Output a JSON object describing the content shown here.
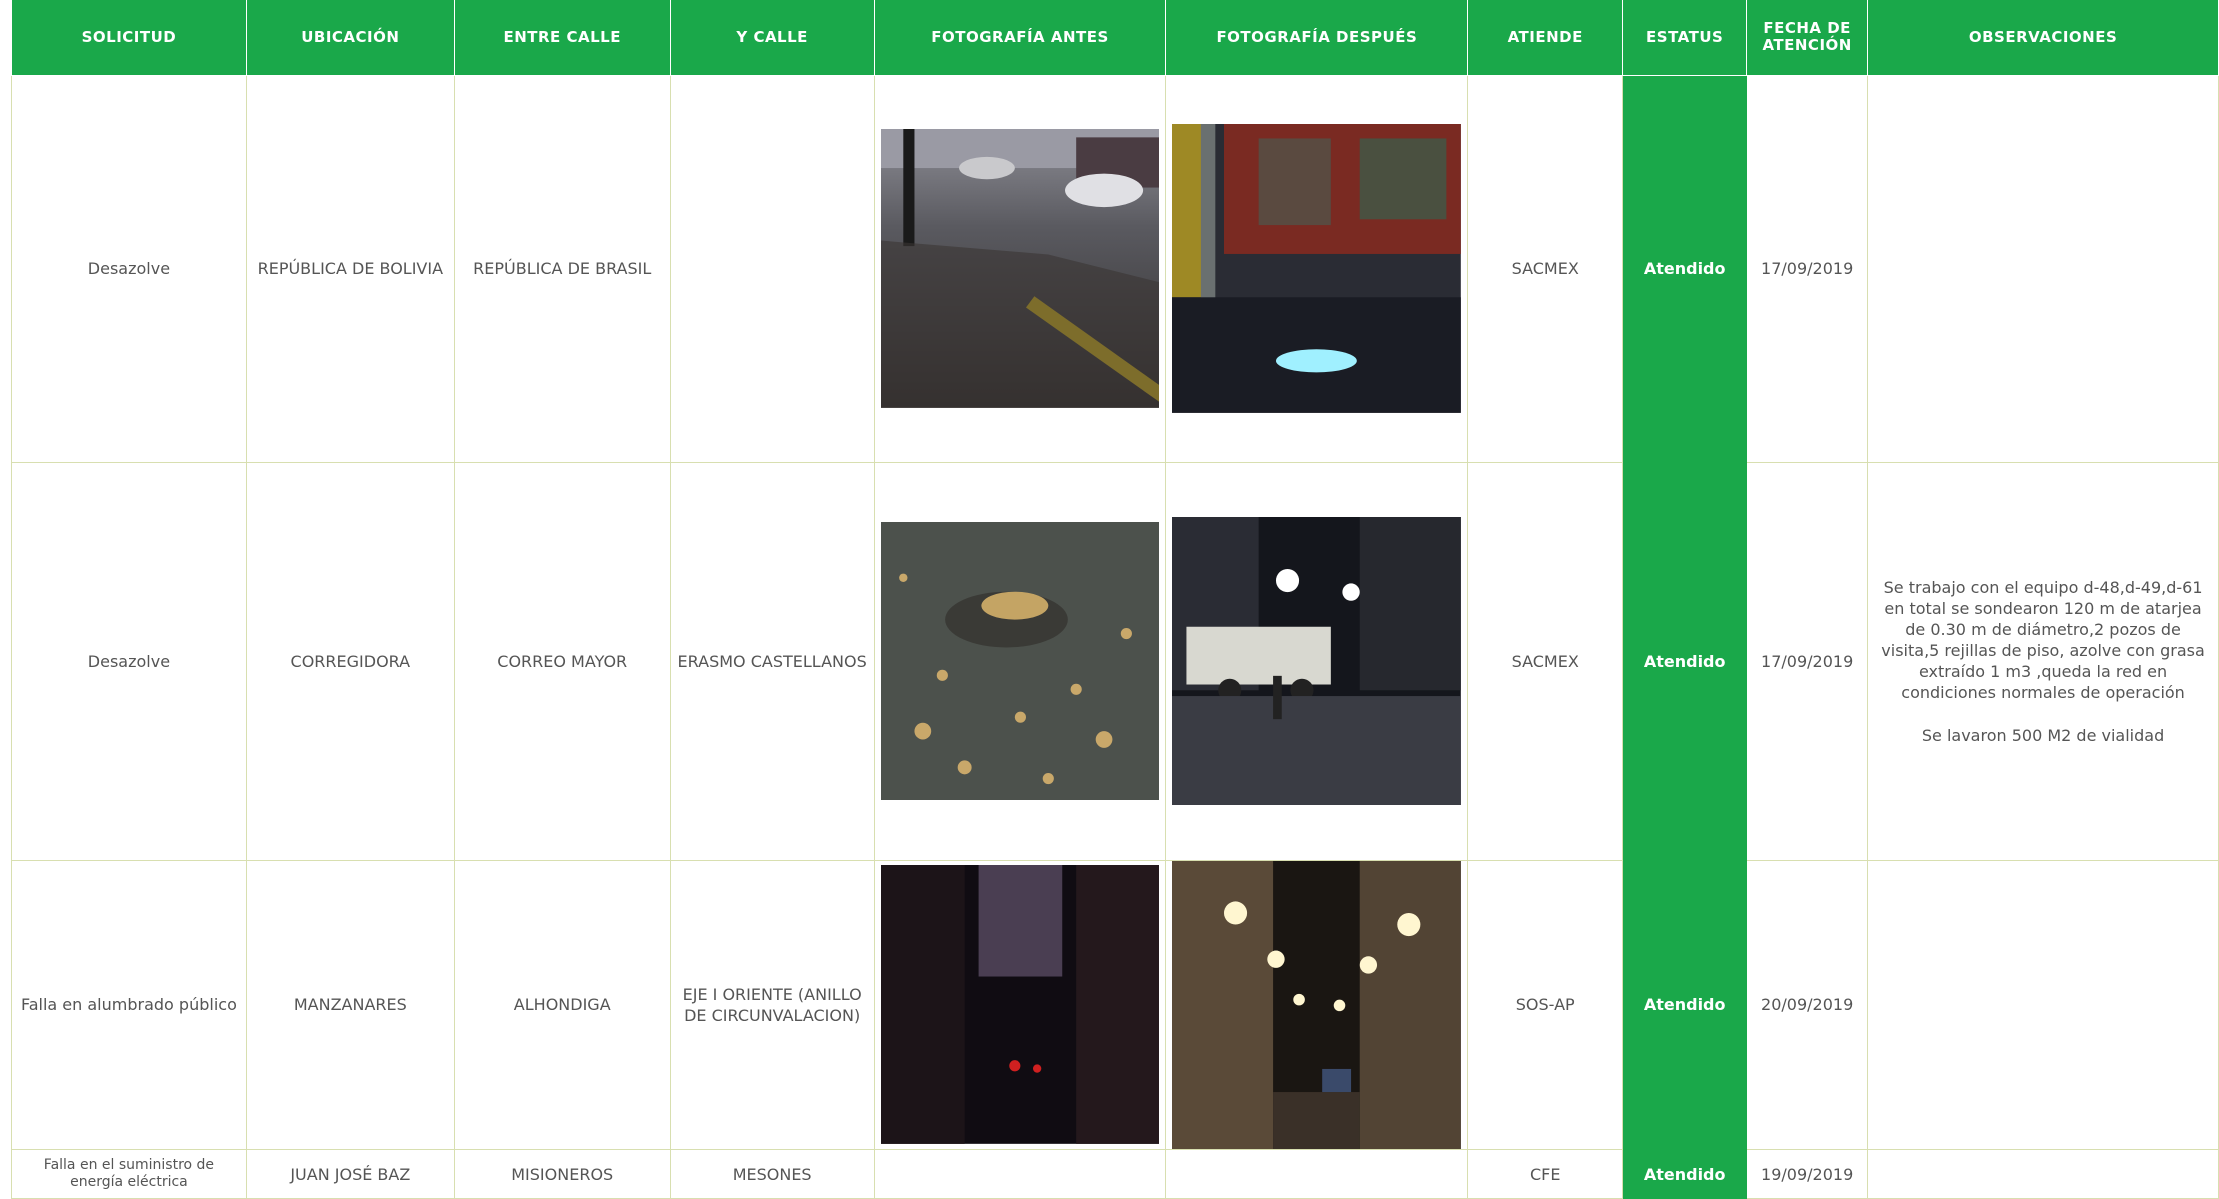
{
  "headers": [
    "SOLICITUD",
    "UBICACIÓN",
    "ENTRE CALLE",
    "Y CALLE",
    "FOTOGRAFÍA ANTES",
    "FOTOGRAFÍA DESPUÉS",
    "ATIENDE",
    "ESTATUS",
    "FECHA DE ATENCIÓN",
    "OBSERVACIONES"
  ],
  "rows": [
    {
      "solicitud": "Desazolve",
      "ubicacion": "REPÚBLICA DE BOLIVIA",
      "entre_calle": "REPÚBLICA DE BRASIL",
      "y_calle": "",
      "atiende": "SACMEX",
      "estatus": "Atendido",
      "fecha": "17/09/2019",
      "observaciones": "",
      "observaciones_2": ""
    },
    {
      "solicitud": "Desazolve",
      "ubicacion": "CORREGIDORA",
      "entre_calle": "CORREO MAYOR",
      "y_calle": "ERASMO CASTELLANOS",
      "atiende": "SACMEX",
      "estatus": "Atendido",
      "fecha": "17/09/2019",
      "observaciones": "Se trabajo con el equipo d-48,d-49,d-61 en total se sondearon 120 m de atarjea de 0.30 m de diámetro,2 pozos de visita,5 rejillas de piso, azolve con grasa extraído 1 m3 ,queda la red en condiciones normales de operación",
      "observaciones_2": "Se lavaron 500 M2 de vialidad"
    },
    {
      "solicitud": "Falla en alumbrado público",
      "ubicacion": "MANZANARES",
      "entre_calle": "ALHONDIGA",
      "y_calle": "EJE I ORIENTE (ANILLO DE CIRCUNVALACION)",
      "atiende": "SOS-AP",
      "estatus": "Atendido",
      "fecha": "20/09/2019",
      "observaciones": "",
      "observaciones_2": ""
    },
    {
      "solicitud": "Falla en el suministro de energía eléctrica",
      "ubicacion": "JUAN JOSÉ BAZ",
      "entre_calle": "MISIONEROS",
      "y_calle": "MESONES",
      "atiende": "CFE",
      "estatus": "Atendido",
      "fecha": "19/09/2019",
      "observaciones": "",
      "observaciones_2": ""
    }
  ],
  "colors": {
    "brand_green": "#1aa84a",
    "grid": "#d8dfb0"
  }
}
